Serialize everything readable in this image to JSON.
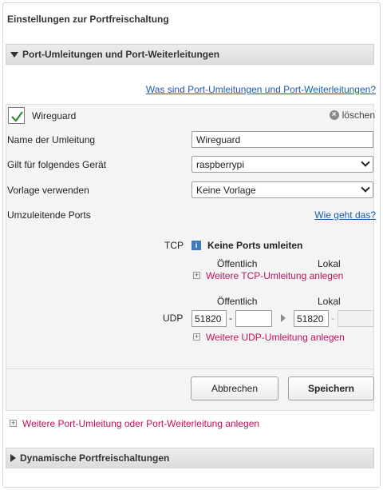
{
  "page_title": "Einstellungen zur Portfreischaltung",
  "section1": {
    "title": "Port-Umleitungen und Port-Weiterleitungen"
  },
  "help_link": "Was sind Port-Umleitungen und Port-Weiterleitungen?",
  "rule": {
    "name_header": "Wireguard",
    "delete_label": "löschen",
    "fields": {
      "name_label": "Name der Umleitung",
      "name_value": "Wireguard",
      "device_label": "Gilt für folgendes Gerät",
      "device_value": "raspberrypi",
      "template_label": "Vorlage verwenden",
      "template_value": "Keine Vorlage",
      "ports_label": "Umzuleitende Ports",
      "ports_help": "Wie geht das?"
    },
    "tcp": {
      "label": "TCP",
      "info_icon_text": "i",
      "status": "Keine Ports umleiten",
      "col_public": "Öffentlich",
      "col_local": "Lokal",
      "add_link": "Weitere TCP-Umleitung anlegen"
    },
    "udp": {
      "label": "UDP",
      "col_public": "Öffentlich",
      "col_local": "Lokal",
      "public_from": "51820",
      "public_to": "",
      "local_from": "51820",
      "local_to": "",
      "dash": "-",
      "add_link": "Weitere UDP-Umleitung anlegen"
    },
    "buttons": {
      "cancel": "Abbrechen",
      "save": "Speichern"
    }
  },
  "add_more_link": "Weitere Port-Umleitung oder Port-Weiterleitung anlegen",
  "section2": {
    "title": "Dynamische Portfreischaltungen"
  },
  "colors": {
    "link_blue": "#1a5ea8",
    "link_pink": "#c0115f",
    "check_green": "#2e8b3a",
    "info_blue": "#3e78bd"
  }
}
